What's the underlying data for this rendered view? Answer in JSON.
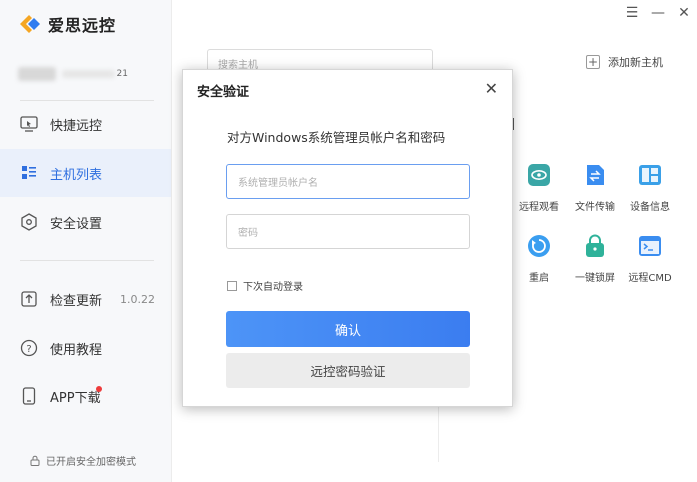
{
  "app": {
    "name": "爱思远控"
  },
  "account": {
    "suffix": "21"
  },
  "sidebar": {
    "items": [
      {
        "label": "快捷远控",
        "icon": "remote-screen-icon"
      },
      {
        "label": "主机列表",
        "icon": "host-list-icon"
      },
      {
        "label": "安全设置",
        "icon": "shield-icon"
      },
      {
        "label": "检查更新",
        "icon": "upload-icon",
        "version": "1.0.22"
      },
      {
        "label": "使用教程",
        "icon": "help-icon"
      },
      {
        "label": "APP下载",
        "icon": "phone-icon"
      }
    ],
    "secure_mode": "已开启安全加密模式"
  },
  "titlebar": {
    "menu": "☰",
    "minimize": "—",
    "close": "✕"
  },
  "main": {
    "search_placeholder": "搜索主机",
    "add_host": "添加新主机",
    "actions": [
      {
        "label": "远程观看",
        "icon": "eye-icon",
        "color": "#3aa6a6"
      },
      {
        "label": "文件传输",
        "icon": "file-transfer-icon",
        "color": "#3a8df0"
      },
      {
        "label": "设备信息",
        "icon": "device-info-icon",
        "color": "#3aa0e8"
      },
      {
        "label": "重启",
        "icon": "restart-icon",
        "color": "#3a9ef0"
      },
      {
        "label": "一键锁屏",
        "icon": "lock-icon",
        "color": "#2fb29a"
      },
      {
        "label": "远程CMD",
        "icon": "cmd-icon",
        "color": "#3a8df0"
      }
    ]
  },
  "modal": {
    "title": "安全验证",
    "description": "对方Windows系统管理员帐户名和密码",
    "username_placeholder": "系统管理员帐户名",
    "password_placeholder": "密码",
    "auto_login_label": "下次自动登录",
    "confirm_label": "确认",
    "verify_label": "远控密码验证"
  },
  "colors": {
    "accent": "#3b7df0",
    "active_bg": "#eaf0fb",
    "notification": "#ee3b3b"
  }
}
